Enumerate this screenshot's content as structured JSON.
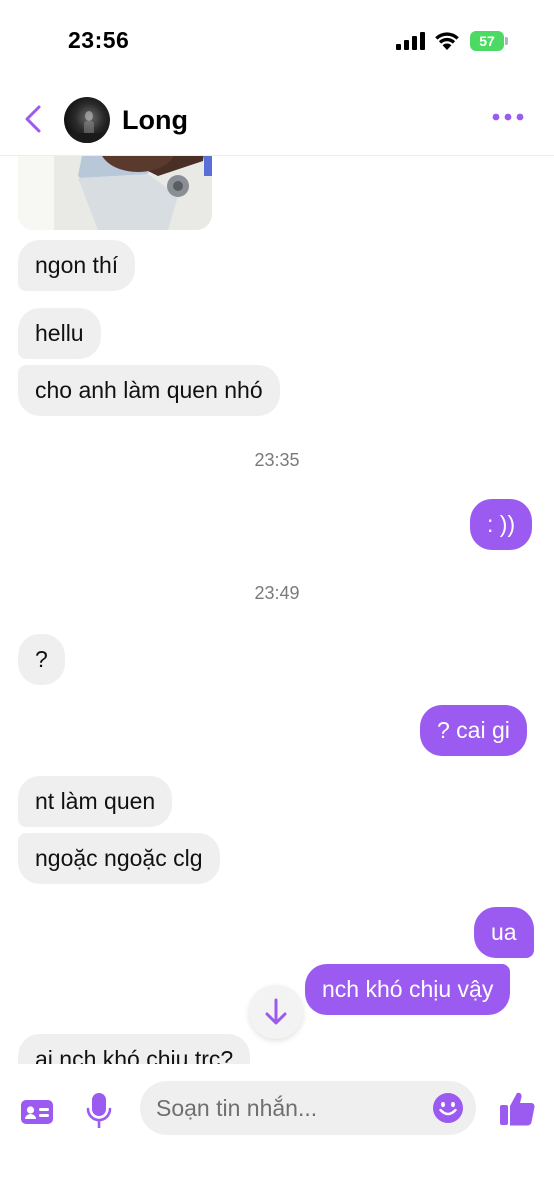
{
  "status_bar": {
    "time": "23:56",
    "battery": "57",
    "signal_icon": "cellular-signal-icon",
    "wifi_icon": "wifi-icon"
  },
  "header": {
    "contact_name": "Long",
    "back_icon": "chevron-left-icon",
    "more_icon": "more-dots-icon"
  },
  "messages": [
    {
      "direction": "in",
      "text": "ngon thí"
    },
    {
      "direction": "in",
      "text": "hellu"
    },
    {
      "direction": "in",
      "text": "cho anh làm quen nhó"
    },
    {
      "type": "timestamp",
      "text": "23:35"
    },
    {
      "direction": "out",
      "text": ": ))"
    },
    {
      "type": "timestamp",
      "text": "23:49"
    },
    {
      "direction": "in",
      "text": "?"
    },
    {
      "direction": "out",
      "text": "? cai gi"
    },
    {
      "direction": "in",
      "text": "nt làm quen"
    },
    {
      "direction": "in",
      "text": "ngoặc ngoặc clg"
    },
    {
      "direction": "out",
      "text": "ua"
    },
    {
      "direction": "out",
      "text": "nch khó chịu vậy"
    },
    {
      "direction": "in",
      "text": "ai nch khó chịu trc?"
    }
  ],
  "composer": {
    "placeholder": "Soạn tin nhắn...",
    "value": ""
  },
  "colors": {
    "accent": "#9b5af0",
    "incoming_bubble": "#efefef",
    "battery": "#4cd964"
  }
}
